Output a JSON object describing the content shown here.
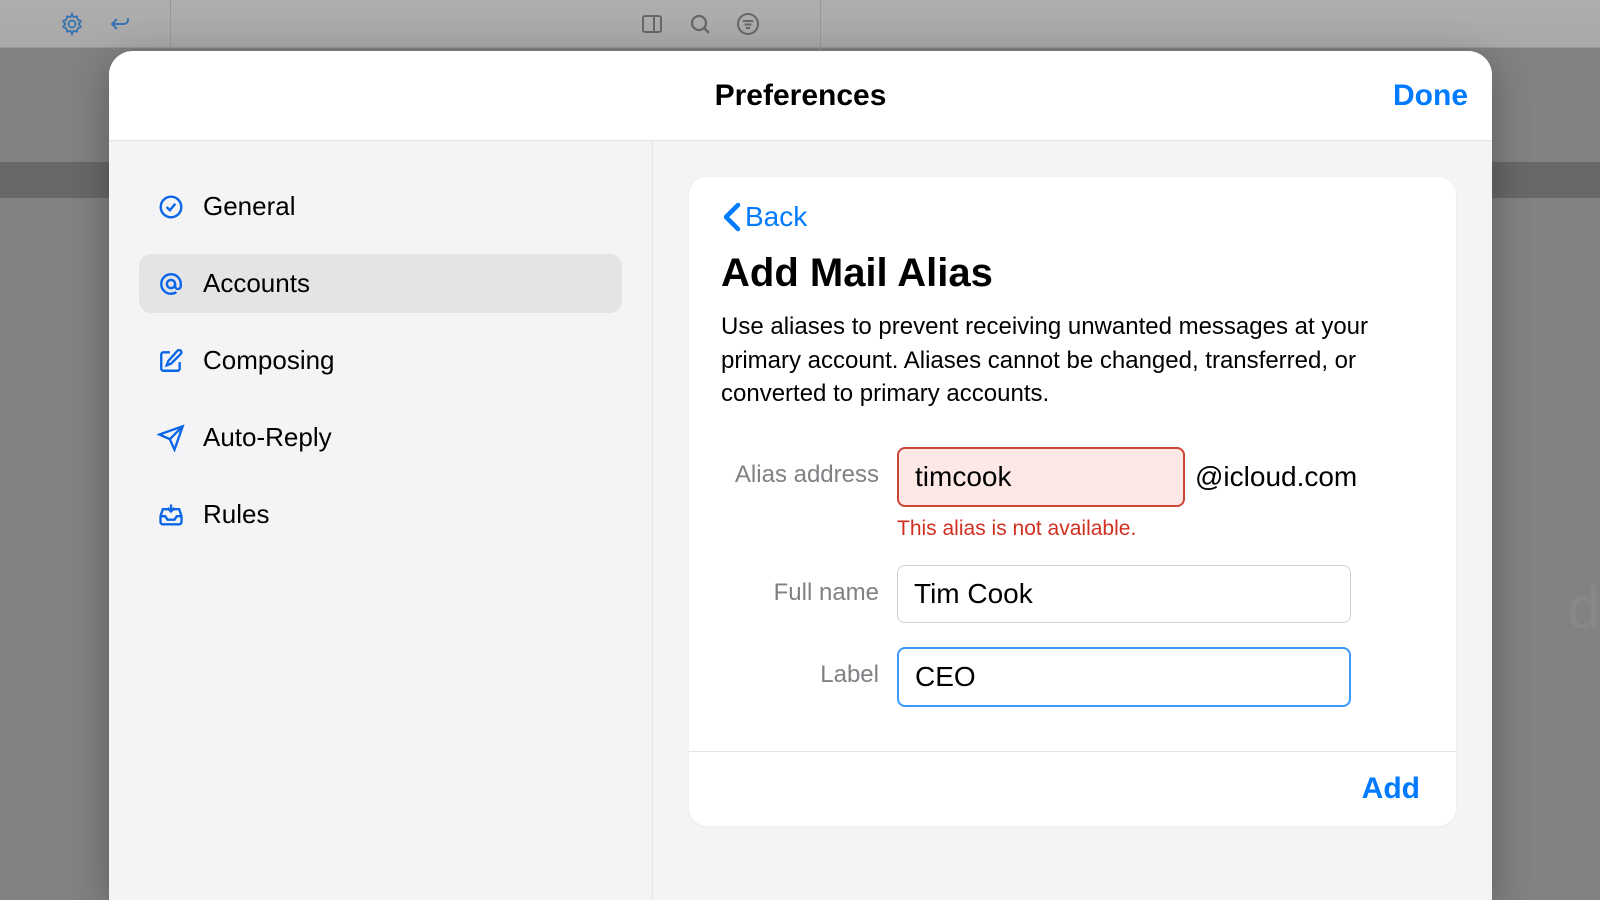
{
  "header": {
    "title": "Preferences",
    "done_label": "Done"
  },
  "sidebar": {
    "items": [
      {
        "label": "General"
      },
      {
        "label": "Accounts"
      },
      {
        "label": "Composing"
      },
      {
        "label": "Auto-Reply"
      },
      {
        "label": "Rules"
      }
    ]
  },
  "panel": {
    "back_label": "Back",
    "heading": "Add Mail Alias",
    "description": "Use aliases to prevent receiving unwanted messages at your primary account. Aliases cannot be changed, transferred, or converted to primary accounts.",
    "alias_label": "Alias address",
    "alias_value": "timcook",
    "domain": "@icloud.com",
    "alias_error": "This alias is not available.",
    "fullname_label": "Full name",
    "fullname_value": "Tim Cook",
    "label_label": "Label",
    "label_value": "CEO",
    "add_label": "Add"
  },
  "bg": {
    "partial_text": "d"
  }
}
